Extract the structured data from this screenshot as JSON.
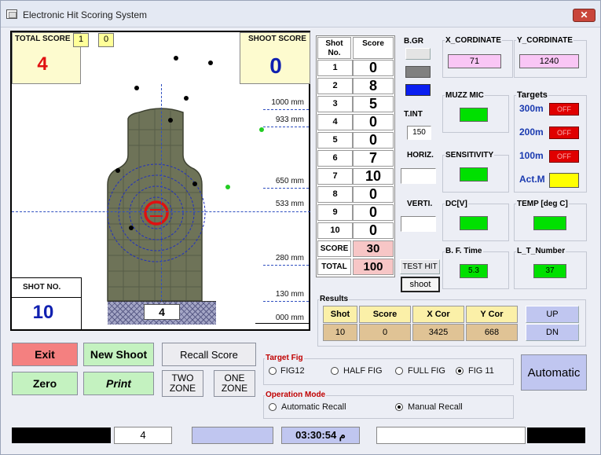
{
  "window": {
    "title": "Electronic Hit Scoring System",
    "close_label": "✕"
  },
  "target": {
    "total_score_label": "TOTAL SCORE",
    "total_score_digits": [
      "1",
      "0"
    ],
    "total_score_value": "4",
    "shoot_score_label": "SHOOT SCORE",
    "shoot_score_value": "0",
    "shot_no_label": "SHOT NO.",
    "shot_no_value": "10",
    "zone_value": "4",
    "mm_labels": [
      "1000 mm",
      "933 mm",
      "650 mm",
      "533 mm",
      "280 mm",
      "130 mm",
      "000 mm"
    ]
  },
  "shot_table": {
    "header_no": "Shot No.",
    "header_score": "Score",
    "rows": [
      {
        "no": "1",
        "score": "0"
      },
      {
        "no": "2",
        "score": "8"
      },
      {
        "no": "3",
        "score": "5"
      },
      {
        "no": "4",
        "score": "0"
      },
      {
        "no": "5",
        "score": "0"
      },
      {
        "no": "6",
        "score": "7"
      },
      {
        "no": "7",
        "score": "10"
      },
      {
        "no": "8",
        "score": "0"
      },
      {
        "no": "9",
        "score": "0"
      },
      {
        "no": "10",
        "score": "0"
      }
    ],
    "score_label": "SCORE",
    "score_value": "30",
    "total_label": "TOTAL",
    "total_value": "100"
  },
  "bgr": {
    "label": "B.GR"
  },
  "tint": {
    "label": "T.INT",
    "value": "150"
  },
  "horiz": {
    "label": "HORIZ."
  },
  "verti": {
    "label": "VERTI."
  },
  "test_hit_label": "TEST HIT",
  "shoot_label": "shoot",
  "x_cord": {
    "label": "X_CORDINATE",
    "value": "71"
  },
  "y_cord": {
    "label": "Y_CORDINATE",
    "value": "1240"
  },
  "muzz_mic": {
    "label": "MUZZ MIC"
  },
  "sensitivity": {
    "label": "SENSITIVITY"
  },
  "dc": {
    "label": "DC[V]"
  },
  "temp": {
    "label": "TEMP [deg C]"
  },
  "bf_time": {
    "label": "B. F. Time",
    "value": "5.3"
  },
  "lt_number": {
    "label": "L_T_Number",
    "value": "37"
  },
  "targets": {
    "label": "Targets",
    "items": [
      {
        "label": "300m",
        "state": "OFF"
      },
      {
        "label": "200m",
        "state": "OFF"
      },
      {
        "label": "100m",
        "state": "OFF"
      }
    ],
    "actm_label": "Act.M"
  },
  "results": {
    "label": "Results",
    "headers": [
      "Shot",
      "Score",
      "X Cor",
      "Y Cor"
    ],
    "values": [
      "10",
      "0",
      "3425",
      "668"
    ],
    "up_label": "UP",
    "dn_label": "DN"
  },
  "buttons": {
    "exit": "Exit",
    "new_shoot": "New Shoot",
    "recall_score": "Recall Score",
    "zero": "Zero",
    "print": "Print",
    "two_zone": "TWO ZONE",
    "one_zone": "ONE ZONE",
    "automatic": "Automatic"
  },
  "target_fig": {
    "label": "Target Fig",
    "options": [
      "FIG12",
      "HALF FIG",
      "FULL FIG",
      "FIG 11"
    ],
    "selected": "FIG 11"
  },
  "operation_mode": {
    "label": "Operation Mode",
    "options": [
      "Automatic Recall",
      "Manual Recall"
    ],
    "selected": "Manual Recall"
  },
  "status": {
    "count": "4",
    "time": "03:30:54 م"
  },
  "colors": {
    "exit_bg": "#f48080",
    "green_btn": "#c4f2c0",
    "off_red": "#e00000",
    "act_yellow": "#ffff00",
    "indicator_green": "#00e000"
  }
}
